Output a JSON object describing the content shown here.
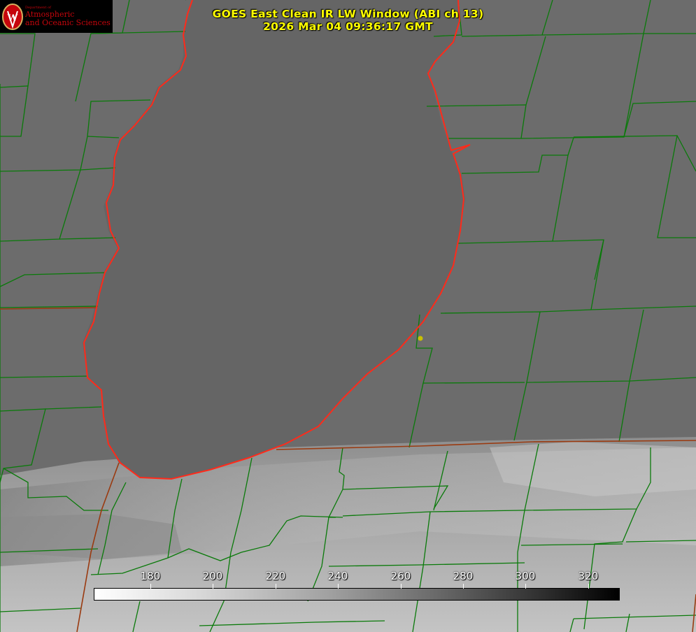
{
  "title": {
    "line1": "GOES East Clean IR LW Window (ABI ch 13)",
    "line2": "2026 Mar 04 09:36:17 GMT"
  },
  "logo": {
    "department": "Department of",
    "line1": "Atmospheric",
    "line2": "and Oceanic Sciences",
    "seal_letter": "W"
  },
  "colorbar": {
    "ticks": [
      "180",
      "200",
      "220",
      "240",
      "260",
      "280",
      "300",
      "320"
    ]
  },
  "colors": {
    "background_land": "#6d6d6d",
    "lake": "#656565",
    "county_lines": "#0a7a0a",
    "shoreline": "#ff2a1a",
    "state_line": "#9a3a10",
    "title_text": "#ffff00",
    "marker": "#c8c000"
  }
}
